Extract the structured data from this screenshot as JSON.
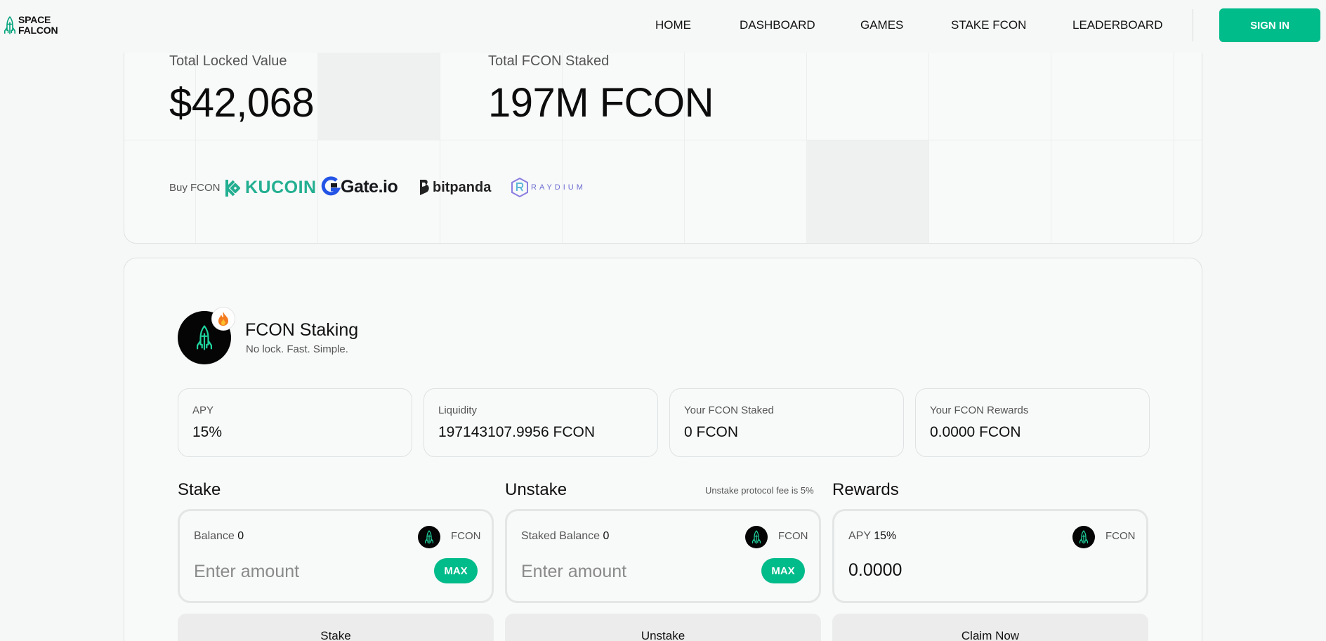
{
  "header": {
    "logo_line1": "SPACE",
    "logo_line2": "FALCON",
    "nav": [
      "HOME",
      "DASHBOARD",
      "GAMES",
      "STAKE FCON",
      "LEADERBOARD"
    ],
    "sign_in": "SIGN IN",
    "accent": "#00bb8a"
  },
  "stats": {
    "tvl_label": "Total Locked Value",
    "tvl_value": "$42,068",
    "staked_label": "Total FCON Staked",
    "staked_value": "197M FCON"
  },
  "buy": {
    "label": "Buy FCON",
    "exchanges": [
      "KUCOIN",
      "Gate.io",
      "bitpanda",
      "RAYDIUM"
    ]
  },
  "pool": {
    "title": "FCON Staking",
    "subtitle": "No lock. Fast. Simple.",
    "stats": [
      {
        "label": "APY",
        "value": "15%"
      },
      {
        "label": "Liquidity",
        "value": "197143107.9956 FCON"
      },
      {
        "label": "Your FCON Staked",
        "value": "0 FCON"
      },
      {
        "label": "Your FCON Rewards",
        "value": "0.0000 FCON"
      }
    ]
  },
  "stake": {
    "title": "Stake",
    "balance_label": "Balance",
    "balance_value": "0",
    "token": "FCON",
    "placeholder": "Enter amount",
    "max": "MAX",
    "button": "Stake"
  },
  "unstake": {
    "title": "Unstake",
    "fee_note": "Unstake protocol fee is 5%",
    "balance_label": "Staked Balance",
    "balance_value": "0",
    "token": "FCON",
    "placeholder": "Enter amount",
    "max": "MAX",
    "button": "Unstake"
  },
  "rewards": {
    "title": "Rewards",
    "apy_label": "APY",
    "apy_value": "15%",
    "token": "FCON",
    "amount": "0.0000",
    "button": "Claim Now"
  }
}
